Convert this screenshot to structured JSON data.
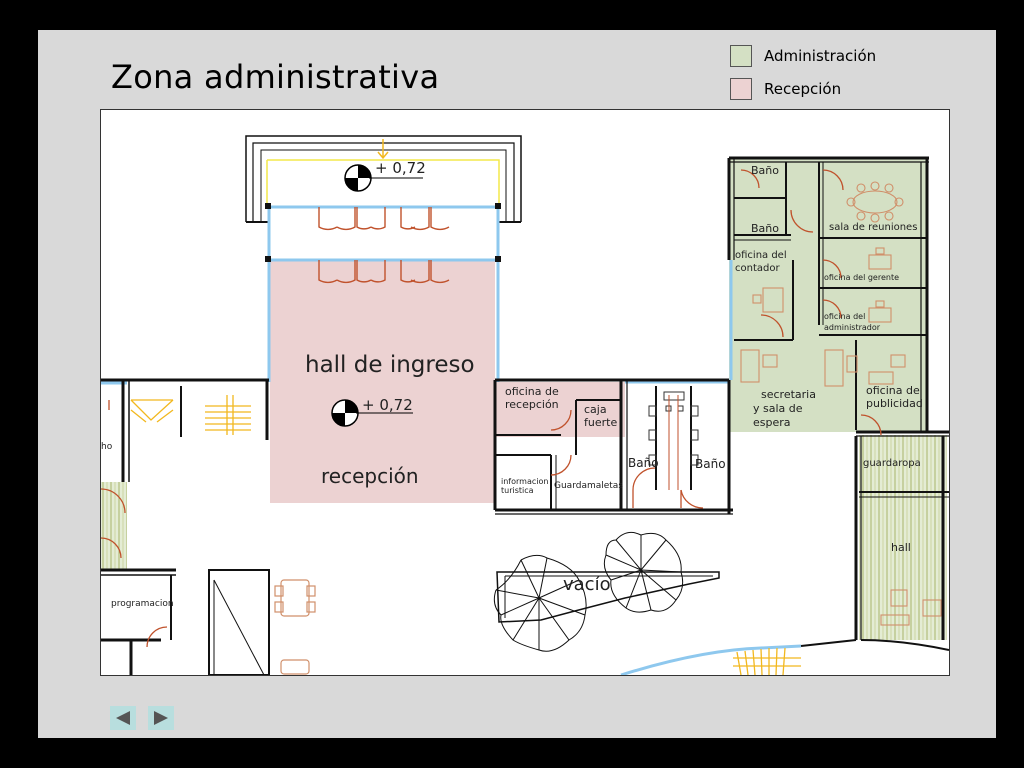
{
  "slide": {
    "title": "Zona administrativa"
  },
  "legend": [
    {
      "label": "Administración",
      "color": "#d4e0c4"
    },
    {
      "label": "Recepción",
      "color": "#ecd2d2"
    }
  ],
  "plan": {
    "levels": {
      "upper": "+ 0,72",
      "hall": "+ 0,72"
    },
    "rooms": {
      "hall_ingreso": "hall de ingreso",
      "recepcion": "recepción",
      "oficina_recepcion_1": "oficina de",
      "oficina_recepcion_2": "recepción",
      "caja_1": "caja",
      "caja_2": "fuerte",
      "informacion_1": "informacion",
      "informacion_2": "turistica",
      "guardamaletas": "Guardamaletas",
      "bano_a": "Baño",
      "bano_b": "Baño",
      "bano_c": "Baño",
      "bano_d": "Baño",
      "sala_reuniones": "sala de reuniones",
      "contador_1": "oficina del",
      "contador_2": "contador",
      "gerente": "oficina del gerente",
      "administrador_1": "oficina del",
      "administrador_2": "administrador",
      "secretaria_1": "secretaria",
      "secretaria_2": "y sala de",
      "secretaria_3": "espera",
      "publicidad_1": "oficina de",
      "publicidad_2": "publicidad",
      "guardaropa": "guardaropa",
      "hall": "hall",
      "vacio": "vacío",
      "programacion": "programacion",
      "cut_label": "ho"
    }
  },
  "navigation": {
    "previous": "previous-arrow",
    "next": "next-arrow"
  },
  "colors": {
    "admin_zone": "#d4e0c4",
    "reception_zone": "#ecd2d2",
    "door": "#c0522c",
    "stair": "#f2b81e",
    "glass": "#8ec8ee"
  }
}
